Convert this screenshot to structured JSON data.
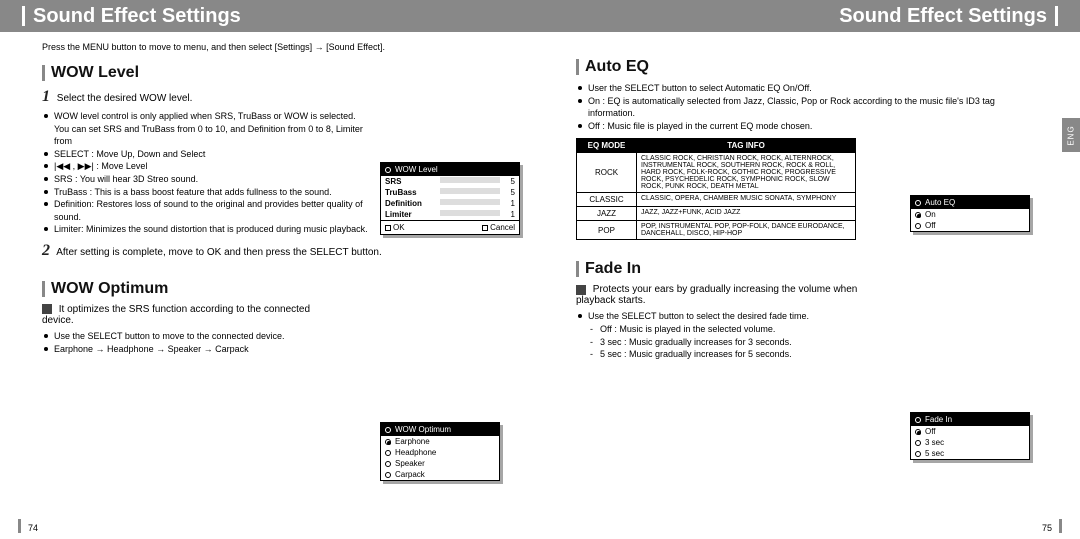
{
  "title_left": "Sound Effect Settings",
  "title_right": "Sound Effect Settings",
  "thumbtab": "ENG",
  "intro": "Press the MENU button to move to menu, and then select [Settings] → [Sound Effect].",
  "page_left_num": "74",
  "page_right_num": "75",
  "wow_level": {
    "heading": "WOW Level",
    "step1": "Select the desired WOW level.",
    "bullets": [
      "WOW level control is only applied when SRS, TruBass or WOW is selected. You can set SRS and TruBass from 0 to 10, and Definition from 0 to 8, Limiter from",
      "SELECT : Move Up, Down and Select",
      "|◀◀ , ▶▶| : Move Level",
      "SRS : You will hear 3D Streo sound.",
      "TruBass : This is a bass boost feature that adds fullness to the sound.",
      "Definition: Restores loss of sound to the original and provides better quality of sound.",
      "Limiter: Minimizes the sound distortion that is produced during music playback."
    ],
    "step2": "After setting is complete, move to OK and then press the SELECT button.",
    "panel": {
      "title": "WOW Level",
      "rows": [
        {
          "label": "SRS",
          "val": "5",
          "pct": 50
        },
        {
          "label": "TruBass",
          "val": "5",
          "pct": 50
        },
        {
          "label": "Definition",
          "val": "1",
          "pct": 12
        },
        {
          "label": "Limiter",
          "val": "1",
          "pct": 12
        }
      ],
      "ok": "OK",
      "cancel": "Cancel"
    }
  },
  "wow_optimum": {
    "heading": "WOW Optimum",
    "lead": "It optimizes the SRS function according to the connected device.",
    "bullets": [
      "Use the SELECT button to move to the connected device.",
      "Earphone → Headphone → Speaker → Carpack"
    ],
    "panel": {
      "title": "WOW Optimum",
      "options": [
        "Earphone",
        "Headphone",
        "Speaker",
        "Carpack"
      ],
      "selected": 0
    }
  },
  "auto_eq": {
    "heading": "Auto EQ",
    "bullets": [
      "User the SELECT button to select Automatic EQ On/Off.",
      "On : EQ is automatically selected from Jazz, Classic, Pop or Rock according to the music file's ID3 tag information.",
      "Off : Music file is played in the current EQ mode chosen."
    ],
    "table": {
      "headers": [
        "EQ MODE",
        "TAG INFO"
      ],
      "rows": [
        {
          "mode": "ROCK",
          "info": "CLASSIC ROCK, CHRISTIAN ROCK, ROCK, ALTERNROCK, INSTRUMENTAL ROCK, SOUTHERN ROCK, ROCK & ROLL, HARD ROCK, FOLK-ROCK, GOTHIC ROCK, PROGRESSIVE ROCK, PSYCHEDELIC ROCK, SYMPHONIC ROCK, SLOW ROCK, PUNK ROCK, DEATH METAL"
        },
        {
          "mode": "CLASSIC",
          "info": "CLASSIC, OPERA, CHAMBER MUSIC SONATA, SYMPHONY"
        },
        {
          "mode": "JAZZ",
          "info": "JAZZ, JAZZ+FUNK, ACID JAZZ"
        },
        {
          "mode": "POP",
          "info": "POP, INSTRUMENTAL POP, POP-FOLK, DANCE EURODANCE, DANCEHALL, DISCO, HIP-HOP"
        }
      ]
    },
    "panel": {
      "title": "Auto EQ",
      "options": [
        "On",
        "Off"
      ],
      "selected": 0
    }
  },
  "fade_in": {
    "heading": "Fade In",
    "lead": "Protects your ears by gradually increasing the volume when playback starts.",
    "bullets": [
      "Use the SELECT button to select the desired fade time.",
      "Off : Music is played in the selected volume.",
      "3 sec : Music gradually increases for 3 seconds.",
      "5 sec : Music gradually increases for 5 seconds."
    ],
    "panel": {
      "title": "Fade In",
      "options": [
        "Off",
        "3 sec",
        "5 sec"
      ],
      "selected": 0
    }
  }
}
